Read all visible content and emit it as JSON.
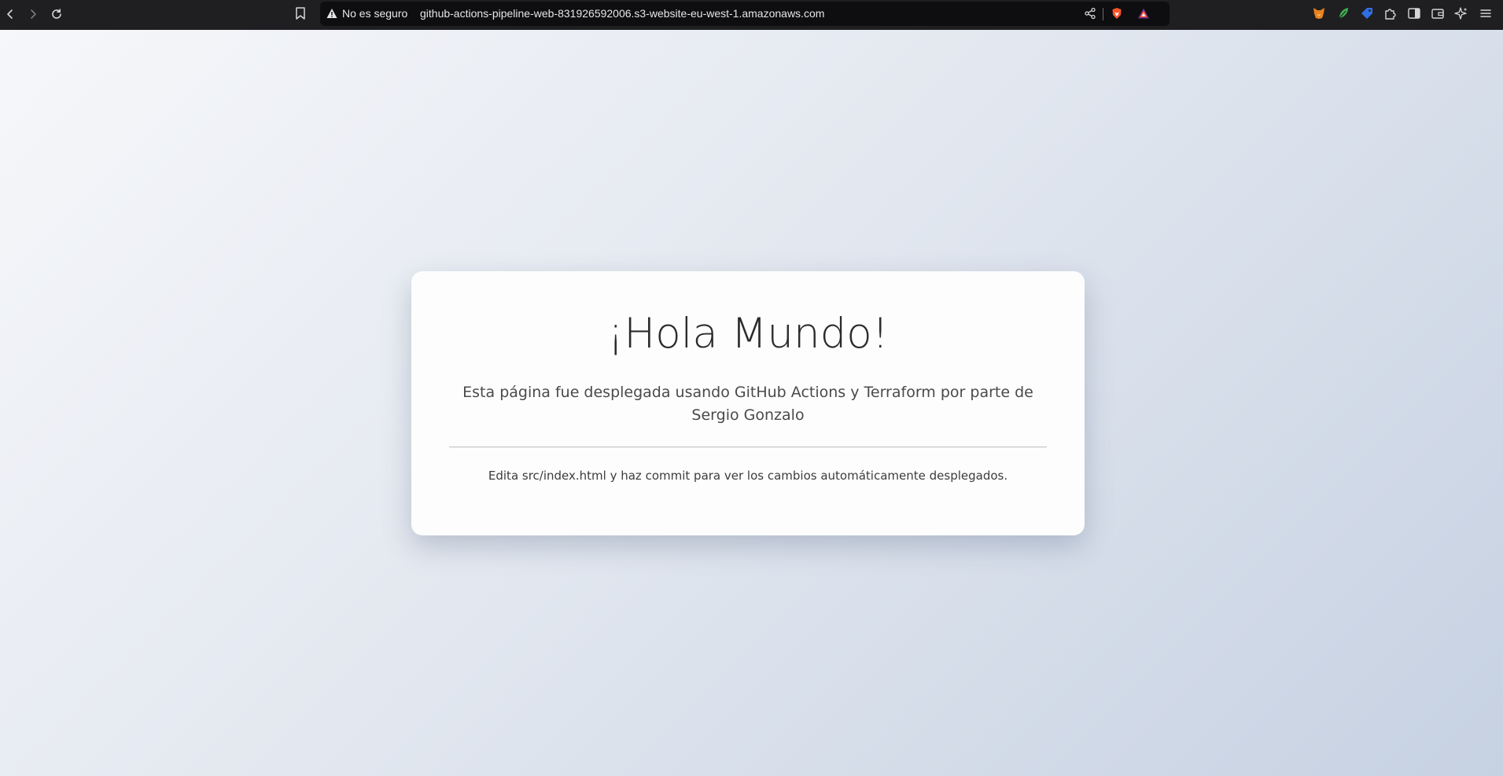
{
  "browser": {
    "security_label": "No es seguro",
    "url": "github-actions-pipeline-web-831926592006.s3-website-eu-west-1.amazonaws.com",
    "icons": {
      "back": "back-arrow-icon",
      "forward": "forward-arrow-icon",
      "reload": "reload-icon",
      "bookmark": "bookmark-icon",
      "security": "warning-icon",
      "share": "share-icon",
      "brave_shields": "brave-shield-icon",
      "brave_rewards": "brave-rewards-icon",
      "extensions": [
        "metamask-fox-icon",
        "leaf-icon",
        "tag-icon",
        "puzzle-extensions-icon",
        "sidebar-icon",
        "wallet-icon",
        "ai-sparkle-icon",
        "menu-icon"
      ]
    },
    "colors": {
      "toolbar": "#1f1f22",
      "urlbar": "#0e0e10"
    }
  },
  "card": {
    "heading": "¡Hola Mundo!",
    "subtitle": "Esta página fue desplegada usando GitHub Actions y Terraform por parte de Sergio Gonzalo",
    "note": "Edita src/index.html y haz commit para ver los cambios automáticamente desplegados."
  },
  "colors": {
    "background_start": "#f6f7fa",
    "background_end": "#c6d1e2",
    "card_background": "#fdfdfd",
    "heading_text": "#2b2b2b"
  }
}
